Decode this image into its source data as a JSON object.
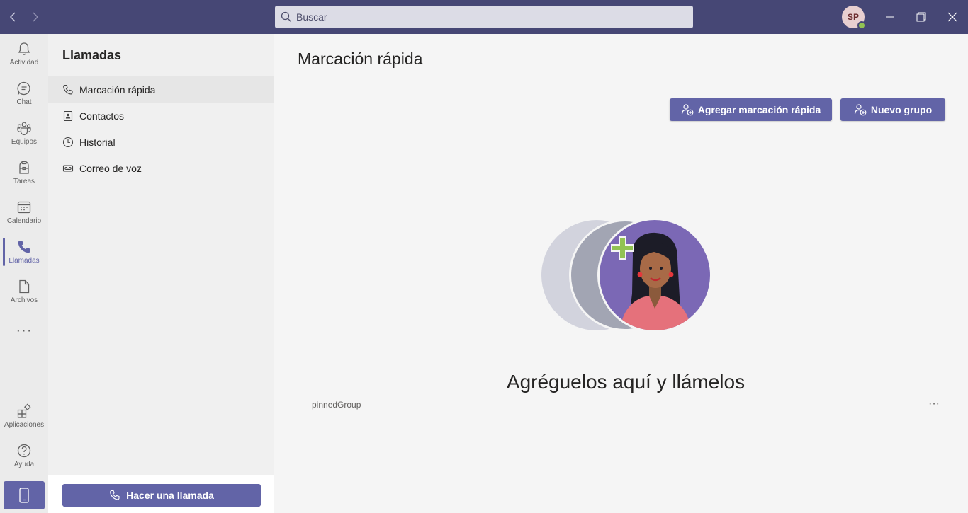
{
  "titlebar": {
    "search_placeholder": "Buscar",
    "avatar_initials": "SP"
  },
  "rail": {
    "items": [
      {
        "label": "Actividad",
        "icon": "bell-icon"
      },
      {
        "label": "Chat",
        "icon": "chat-icon"
      },
      {
        "label": "Equipos",
        "icon": "teams-icon"
      },
      {
        "label": "Tareas",
        "icon": "tasks-icon"
      },
      {
        "label": "Calendario",
        "icon": "calendar-icon"
      },
      {
        "label": "Llamadas",
        "icon": "phone-icon",
        "active": true
      },
      {
        "label": "Archivos",
        "icon": "file-icon"
      }
    ],
    "more": "···",
    "bottom_items": [
      {
        "label": "Aplicaciones",
        "icon": "apps-icon"
      },
      {
        "label": "Ayuda",
        "icon": "help-icon"
      }
    ]
  },
  "leftpane": {
    "title": "Llamadas",
    "items": [
      {
        "label": "Marcación rápida",
        "icon": "phone-outline-icon",
        "selected": true
      },
      {
        "label": "Contactos",
        "icon": "contact-card-icon"
      },
      {
        "label": "Historial",
        "icon": "clock-icon"
      },
      {
        "label": "Correo de voz",
        "icon": "voicemail-icon"
      }
    ],
    "call_button": "Hacer una llamada"
  },
  "main": {
    "title": "Marcación rápida",
    "add_speed_dial": "Agregar marcación rápida",
    "new_group": "Nuevo grupo",
    "empty_title": "Agréguelos aquí y llámelos",
    "pinned_group": "pinnedGroup",
    "more": "···"
  },
  "colors": {
    "titlebar": "#464775",
    "accent": "#6264a7",
    "rail": "#ebebeb",
    "pane": "#f0f0f0",
    "main": "#f5f5f5",
    "presence": "#92c353"
  }
}
